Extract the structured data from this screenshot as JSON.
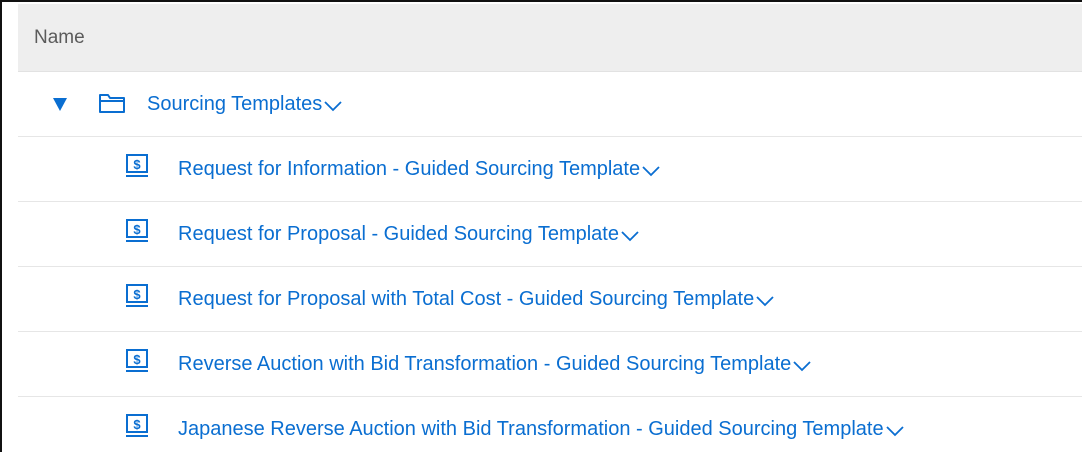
{
  "header": {
    "name_label": "Name"
  },
  "folder": {
    "label": "Sourcing Templates",
    "expanded": true,
    "toggle_icon": "triangle-down-icon",
    "icon": "folder-icon"
  },
  "templates": [
    {
      "label": "Request for Information - Guided Sourcing Template",
      "icon": "sourcing-template-icon"
    },
    {
      "label": "Request for Proposal - Guided Sourcing Template",
      "icon": "sourcing-template-icon"
    },
    {
      "label": "Request for Proposal with Total Cost - Guided Sourcing Template",
      "icon": "sourcing-template-icon"
    },
    {
      "label": "Reverse Auction with Bid Transformation - Guided Sourcing Template",
      "icon": "sourcing-template-icon"
    },
    {
      "label": "Japanese Reverse Auction with Bid Transformation - Guided Sourcing Template",
      "icon": "sourcing-template-icon"
    }
  ],
  "colors": {
    "link": "#0a6ed1",
    "header_bg": "#eeeeee",
    "header_text": "#5b5b5b",
    "row_divider": "#e6e6e6"
  }
}
